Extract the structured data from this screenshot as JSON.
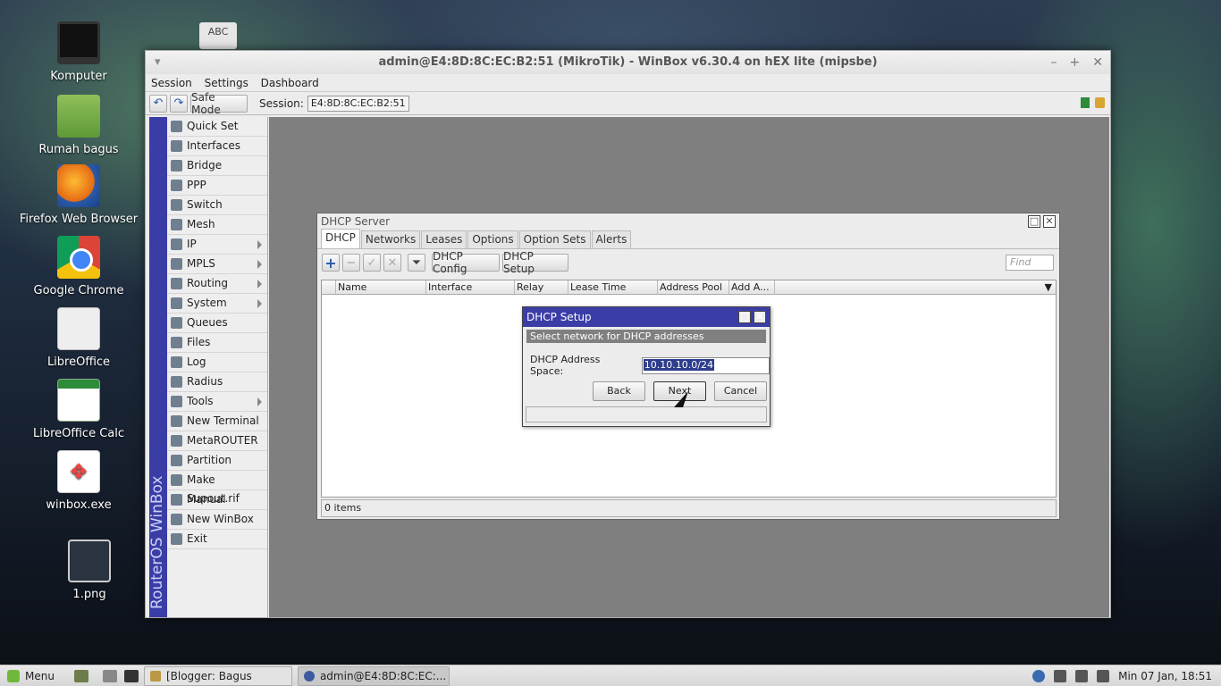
{
  "desktop": {
    "icons": [
      {
        "label": "Komputer",
        "icon": "monitor-icon"
      },
      {
        "label": "Rumah bagus",
        "icon": "home-folder-icon"
      },
      {
        "label": "Firefox Web Browser",
        "icon": "firefox-icon"
      },
      {
        "label": "Google Chrome",
        "icon": "chrome-icon"
      },
      {
        "label": "LibreOffice",
        "icon": "libreoffice-icon"
      },
      {
        "label": "LibreOffice Calc",
        "icon": "calc-icon"
      },
      {
        "label": "winbox.exe",
        "icon": "exe-icon"
      },
      {
        "label": "1.png",
        "icon": "image-file-icon"
      }
    ],
    "abc_text": "ABC"
  },
  "window": {
    "title": "admin@E4:8D:8C:EC:B2:51 (MikroTik) - WinBox v6.30.4 on hEX lite (mipsbe)",
    "menu": [
      "Session",
      "Settings",
      "Dashboard"
    ],
    "safe_mode": "Safe Mode",
    "session_label": "Session:",
    "session_value": "E4:8D:8C:EC:B2:51"
  },
  "sidebar": {
    "brand": "RouterOS WinBox",
    "items": [
      {
        "label": "Quick Set",
        "sub": false
      },
      {
        "label": "Interfaces",
        "sub": false
      },
      {
        "label": "Bridge",
        "sub": false
      },
      {
        "label": "PPP",
        "sub": false
      },
      {
        "label": "Switch",
        "sub": false
      },
      {
        "label": "Mesh",
        "sub": false
      },
      {
        "label": "IP",
        "sub": true
      },
      {
        "label": "MPLS",
        "sub": true
      },
      {
        "label": "Routing",
        "sub": true
      },
      {
        "label": "System",
        "sub": true
      },
      {
        "label": "Queues",
        "sub": false
      },
      {
        "label": "Files",
        "sub": false
      },
      {
        "label": "Log",
        "sub": false
      },
      {
        "label": "Radius",
        "sub": false
      },
      {
        "label": "Tools",
        "sub": true
      },
      {
        "label": "New Terminal",
        "sub": false
      },
      {
        "label": "MetaROUTER",
        "sub": false
      },
      {
        "label": "Partition",
        "sub": false
      },
      {
        "label": "Make Supout.rif",
        "sub": false
      },
      {
        "label": "Manual",
        "sub": false
      },
      {
        "label": "New WinBox",
        "sub": false
      },
      {
        "label": "Exit",
        "sub": false
      }
    ]
  },
  "dhcp_server": {
    "title": "DHCP Server",
    "tabs": [
      "DHCP",
      "Networks",
      "Leases",
      "Options",
      "Option Sets",
      "Alerts"
    ],
    "active_tab": "DHCP",
    "buttons": {
      "config": "DHCP Config",
      "setup": "DHCP Setup"
    },
    "find_placeholder": "Find",
    "columns": [
      "Name",
      "Interface",
      "Relay",
      "Lease Time",
      "Address Pool",
      "Add A..."
    ],
    "status": "0 items"
  },
  "dhcp_setup": {
    "title": "DHCP Setup",
    "band": "Select network for DHCP addresses",
    "field_label": "DHCP Address Space:",
    "field_value": "10.10.10.0/24",
    "back": "Back",
    "next": "Next",
    "cancel": "Cancel"
  },
  "taskbar": {
    "menu": "Menu",
    "tasks": [
      "[Blogger: Bagus Cahy...",
      "admin@E4:8D:8C:EC:..."
    ],
    "clock": "Min 07 Jan, 18:51"
  }
}
